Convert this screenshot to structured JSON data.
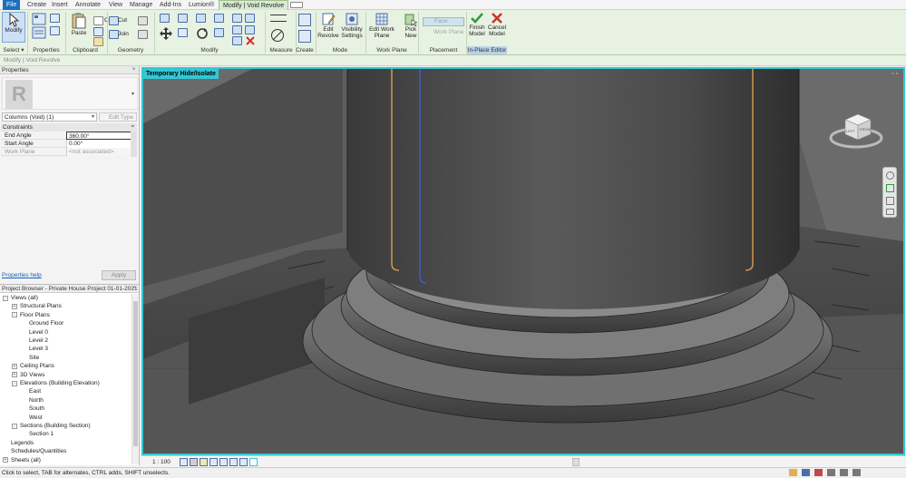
{
  "menu": {
    "tabs": [
      "File",
      "Create",
      "Insert",
      "Annotate",
      "View",
      "Manage",
      "Add-Ins",
      "Lumion®",
      "Modify | Void Revolve"
    ]
  },
  "ribbon": {
    "modify_label": "Modify",
    "select_label": "Select ▾",
    "properties_label": "Properties",
    "paste_label": "Paste",
    "clipboard_label": "Clipboard",
    "cut_label": "Cut",
    "join_label": "Join",
    "geometry_label": "Geometry",
    "modify_group_label": "Modify",
    "measure_label": "Measure",
    "create_label": "Create",
    "edit_revolve_label": "Edit Revolve",
    "visibility_settings_label": "Visibility Settings",
    "mode_label": "Mode",
    "edit_work_plane_label": "Edit Work Plane",
    "work_plane_group_label": "Work Plane",
    "pick_new_label": "Pick New",
    "face_label": "Face",
    "work_plane_small_label": "Work Plane",
    "placement_label": "Placement",
    "finish_model_label": "Finish Model",
    "cancel_model_label": "Cancel Model",
    "in_place_editor_label": "In-Place Editor"
  },
  "context_bar": {
    "text": "Modify | Void Revolve"
  },
  "properties": {
    "title": "Properties",
    "type_selector": "Columns (Void) (1)",
    "edit_type": "Edit Type",
    "section_constraints": "Constraints",
    "rows": [
      {
        "name": "End Angle",
        "value": "360.00°"
      },
      {
        "name": "Start Angle",
        "value": "0.00°"
      },
      {
        "name": "Work Plane",
        "value": "<not associated>"
      }
    ],
    "help_link": "Properties help",
    "apply": "Apply"
  },
  "project_browser": {
    "title": "Project Browser - Private House Project 01-01-2021",
    "nodes": [
      {
        "label": "Views (all)",
        "level": 0,
        "toggle": "-"
      },
      {
        "label": "Structural Plans",
        "level": 1,
        "toggle": "+"
      },
      {
        "label": "Floor Plans",
        "level": 1,
        "toggle": "-"
      },
      {
        "label": "Ground Floor",
        "level": 2,
        "toggle": ""
      },
      {
        "label": "Level 0",
        "level": 2,
        "toggle": ""
      },
      {
        "label": "Level 2",
        "level": 2,
        "toggle": ""
      },
      {
        "label": "Level 3",
        "level": 2,
        "toggle": ""
      },
      {
        "label": "Site",
        "level": 2,
        "toggle": ""
      },
      {
        "label": "Ceiling Plans",
        "level": 1,
        "toggle": "+"
      },
      {
        "label": "3D Views",
        "level": 1,
        "toggle": "+"
      },
      {
        "label": "Elevations (Building Elevation)",
        "level": 1,
        "toggle": "-"
      },
      {
        "label": "East",
        "level": 2,
        "toggle": ""
      },
      {
        "label": "North",
        "level": 2,
        "toggle": ""
      },
      {
        "label": "South",
        "level": 2,
        "toggle": ""
      },
      {
        "label": "West",
        "level": 2,
        "toggle": ""
      },
      {
        "label": "Sections (Building Section)",
        "level": 1,
        "toggle": "-"
      },
      {
        "label": "Section 1",
        "level": 2,
        "toggle": ""
      },
      {
        "label": "Legends",
        "level": 0,
        "toggle": ""
      },
      {
        "label": "Schedules/Quantities",
        "level": 0,
        "toggle": ""
      },
      {
        "label": "Sheets (all)",
        "level": 0,
        "toggle": "+"
      }
    ]
  },
  "view": {
    "tag": "Temporary Hide/Isolate",
    "scale": "1 : 100",
    "viewcube_front": "LEFT",
    "viewcube_right": "FRONT"
  },
  "status": {
    "text": "Click to select, TAB for alternates, CTRL adds, SHIFT unselects."
  },
  "colors": {
    "accent": "#33c7d3",
    "file_tab": "#1d6fbd",
    "ribbon_bg": "#e8f2e2"
  }
}
